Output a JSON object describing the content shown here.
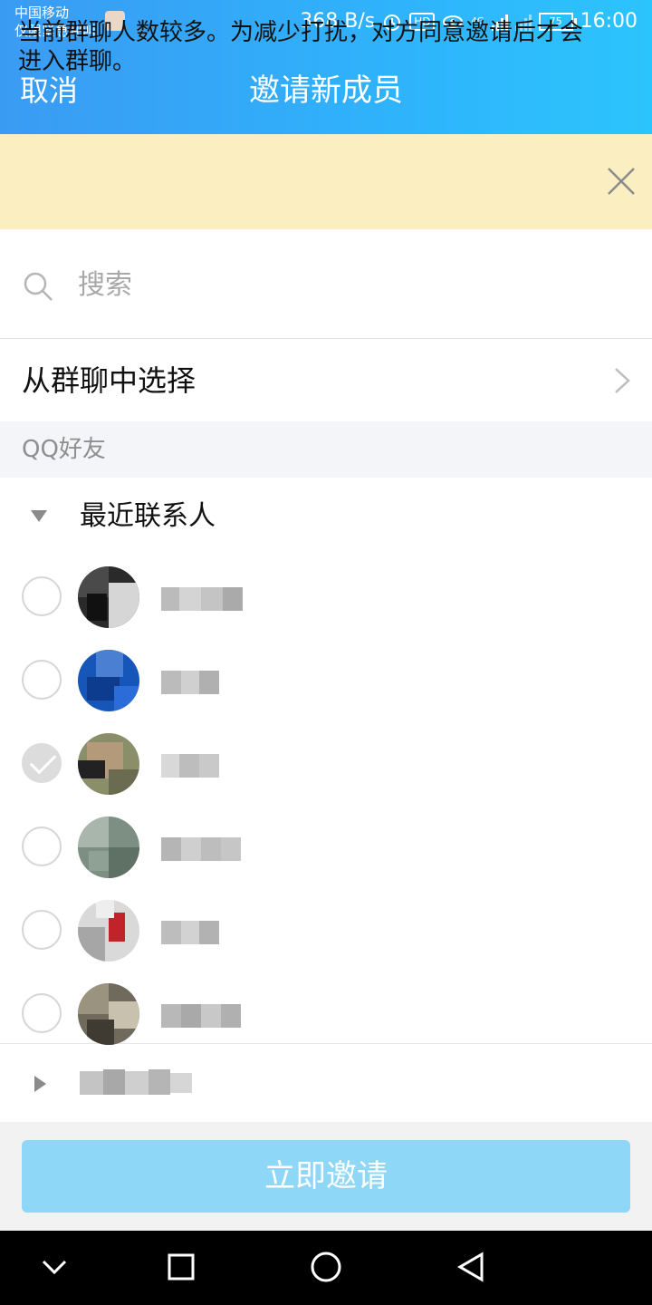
{
  "status_bar": {
    "carrier_line1": "中国移动",
    "carrier_line2": "仅限紧急呼叫",
    "net_speed": "368 B/s",
    "hd_badge": "HD",
    "network": "4G",
    "battery": "75",
    "time": "16:00"
  },
  "header": {
    "cancel": "取消",
    "title": "邀请新成员"
  },
  "notice": {
    "text": "当前群聊人数较多。为减少打扰，对方同意邀请后才会进入群聊。",
    "close_icon": "close-icon"
  },
  "search": {
    "placeholder": "搜索"
  },
  "from_group": {
    "label": "从群聊中选择"
  },
  "section": {
    "label": "QQ好友"
  },
  "groups": [
    {
      "label": "最近联系人",
      "expanded": true
    }
  ],
  "contacts": [
    {
      "checked": false
    },
    {
      "checked": false
    },
    {
      "checked": true
    },
    {
      "checked": false
    },
    {
      "checked": false
    },
    {
      "checked": false
    }
  ],
  "footer": {
    "invite_button": "立即邀请"
  },
  "colors": {
    "header_start": "#3a9bf3",
    "header_end": "#2cc4fd",
    "notice_bg": "#fbeec1",
    "button": "#8fd7f6"
  }
}
